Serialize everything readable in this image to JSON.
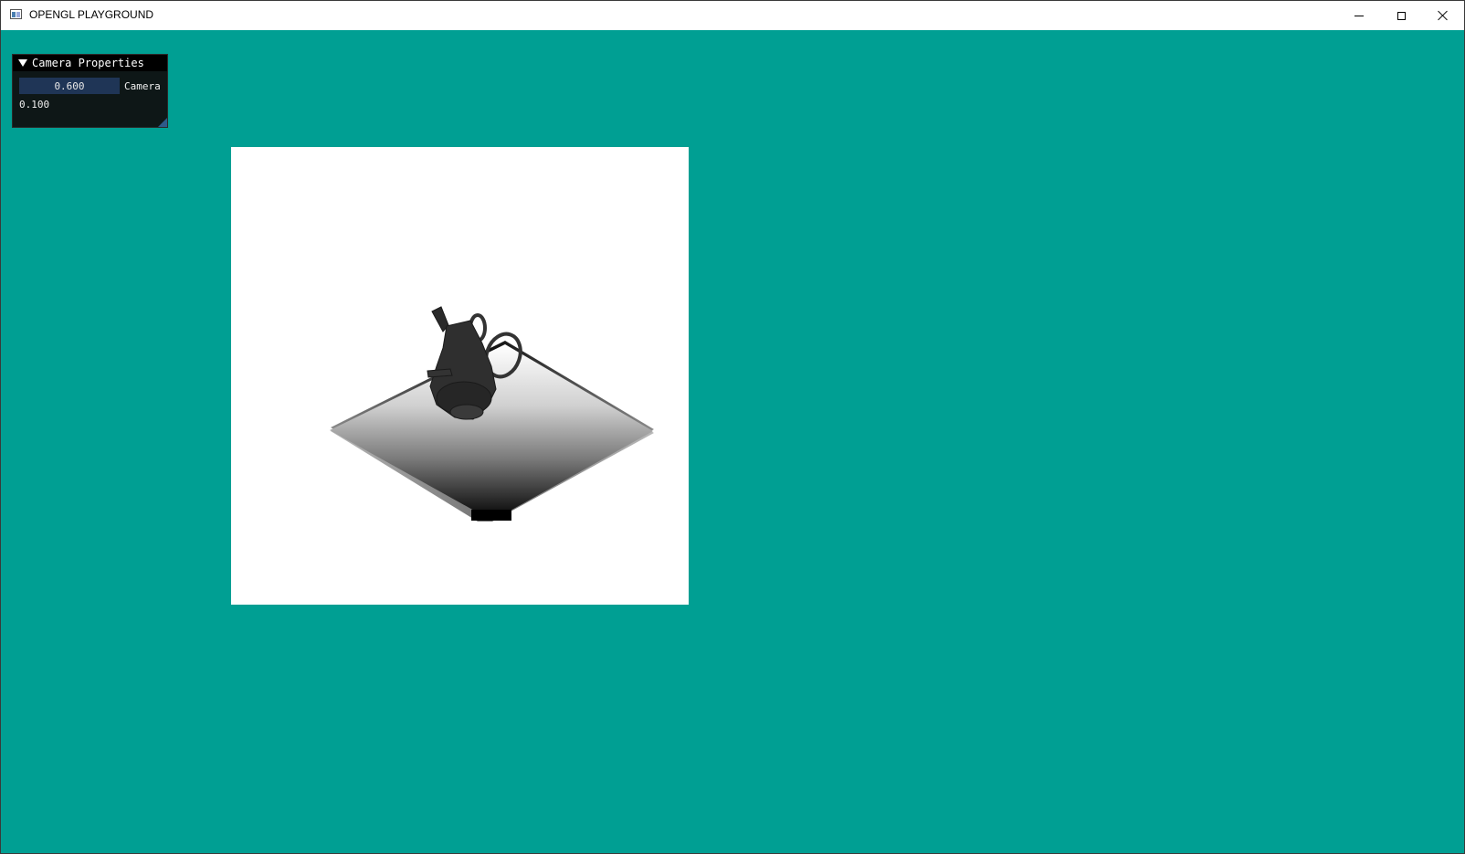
{
  "window": {
    "title": "OPENGL PLAYGROUND",
    "icons": {
      "app": "app-window-icon",
      "minimize": "minimize-icon",
      "maximize": "maximize-icon",
      "close": "close-icon"
    },
    "background_color": "#009f93"
  },
  "camera_panel": {
    "title": "Camera Properties",
    "collapse_icon": "triangle-down-icon",
    "slider": {
      "value": "0.600",
      "label": "Camera"
    },
    "secondary_value": "0.100"
  },
  "viewport": {
    "background_color": "#ffffff",
    "scene_description_icon": "rendered-3d-scene"
  }
}
